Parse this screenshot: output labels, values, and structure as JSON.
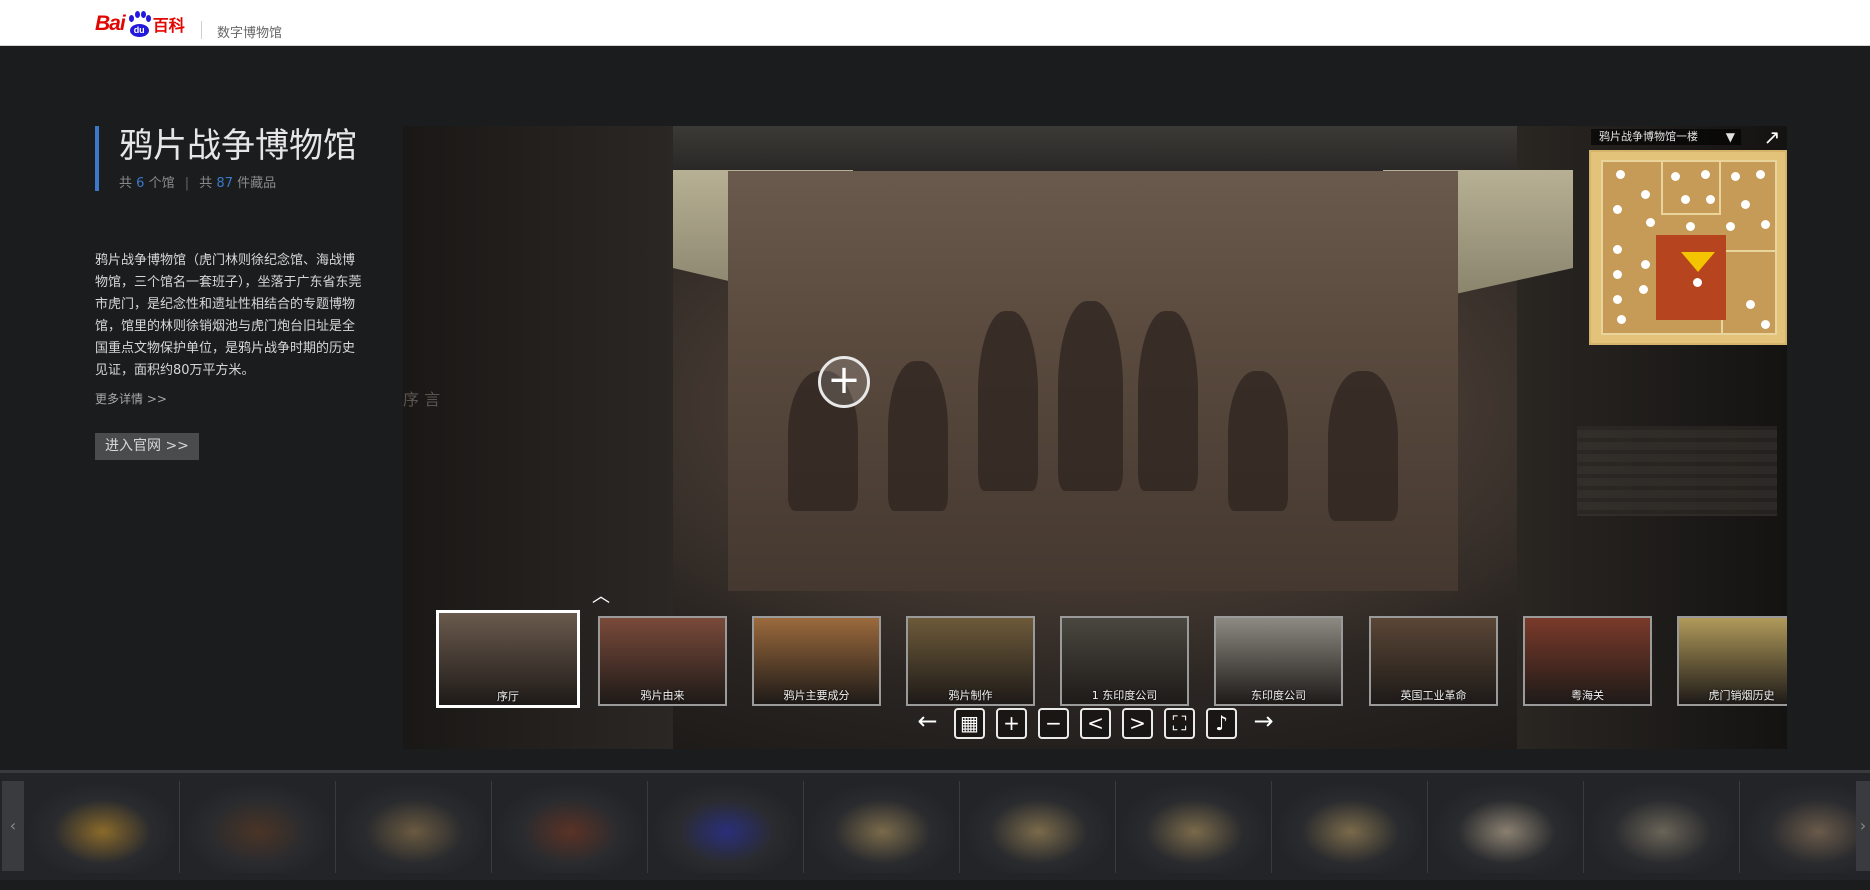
{
  "header": {
    "logo_text": "Bai",
    "logo_du": "du",
    "logo_baike": "百科",
    "subtitle": "数字博物馆"
  },
  "museum": {
    "title": "鸦片战争博物馆",
    "halls_prefix": "共",
    "halls_count": "6",
    "halls_suffix": "个馆",
    "separator": "|",
    "items_prefix": "共",
    "items_count": "87",
    "items_suffix": "件藏品",
    "description": "鸦片战争博物馆（虎门林则徐纪念馆、海战博物馆，三个馆名一套班子），坐落于广东省东莞市虎门，是纪念性和遗址性相结合的专题博物馆，馆里的林则徐销烟池与虎门炮台旧址是全国重点文物保护单位，是鸦片战争时期的历史见证，面积约80万平方米。",
    "more_link": "更多详情 >>",
    "site_button": "进入官网 >>"
  },
  "viewer": {
    "wall_text": "序 言",
    "minimap_title": "鸦片战争博物馆一楼",
    "minimap_arrow": "▼",
    "expand_glyph": "↗",
    "hotspot_glyph": "+",
    "collapse_glyph": "︿",
    "scenes": [
      {
        "label": "序厅",
        "color": "#6a5a4d"
      },
      {
        "label": "鸦片由来",
        "color": "#7a4a3a"
      },
      {
        "label": "鸦片主要成分",
        "color": "#9b6a3c"
      },
      {
        "label": "鸦片制作",
        "color": "#6d5a3a"
      },
      {
        "label": "1 东印度公司",
        "color": "#4a4740"
      },
      {
        "label": "东印度公司",
        "color": "#8c8a82"
      },
      {
        "label": "英国工业革命",
        "color": "#5a4636"
      },
      {
        "label": "粤海关",
        "color": "#7a3a2a"
      },
      {
        "label": "虎门销烟历史",
        "color": "#b09a5a"
      }
    ],
    "controls": [
      {
        "name": "prev-arrow-icon",
        "glyph": "←",
        "style": "plain"
      },
      {
        "name": "grid-icon",
        "glyph": "▦",
        "style": "box"
      },
      {
        "name": "zoom-in-icon",
        "glyph": "+",
        "style": "box"
      },
      {
        "name": "zoom-out-icon",
        "glyph": "−",
        "style": "box"
      },
      {
        "name": "chevron-left-icon",
        "glyph": "<",
        "style": "box"
      },
      {
        "name": "chevron-right-icon",
        "glyph": ">",
        "style": "box"
      },
      {
        "name": "fullscreen-icon",
        "glyph": "⛶",
        "style": "box"
      },
      {
        "name": "sound-icon",
        "glyph": "♪",
        "style": "box"
      },
      {
        "name": "next-arrow-icon",
        "glyph": "→",
        "style": "plain"
      }
    ]
  },
  "collection": {
    "left_arrow": "‹",
    "right_arrow": "›",
    "items": [
      {
        "name": "powder-horn",
        "color": "#8a6a2a"
      },
      {
        "name": "leather-bucket",
        "color": "#4a3426"
      },
      {
        "name": "bottle",
        "color": "#6a5a40"
      },
      {
        "name": "leather-pot",
        "color": "#5a3226"
      },
      {
        "name": "flag",
        "color": "#2a2f7a"
      },
      {
        "name": "sword-1",
        "color": "#7a6a4a"
      },
      {
        "name": "sword-2",
        "color": "#7a6a4a"
      },
      {
        "name": "sword-3",
        "color": "#7a6a4a"
      },
      {
        "name": "sword-4",
        "color": "#7a6a4a"
      },
      {
        "name": "swords-pair",
        "color": "#8a8070"
      },
      {
        "name": "spades",
        "color": "#6a6458"
      },
      {
        "name": "axe",
        "color": "#6a5a4a"
      }
    ]
  }
}
